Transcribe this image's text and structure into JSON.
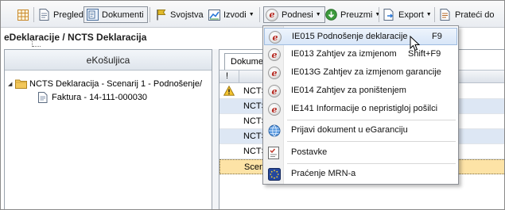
{
  "toolbar": {
    "items": [
      {
        "label": "",
        "icon": "grid-icon"
      },
      {
        "label": "Pregled",
        "icon": "page-icon"
      },
      {
        "label": "Dokumenti",
        "icon": "documents-icon"
      },
      {
        "label": "Svojstva",
        "icon": "flag-icon"
      },
      {
        "label": "Izvodi",
        "icon": "chart-icon"
      },
      {
        "label": "Podnesi",
        "icon": "e-icon"
      },
      {
        "label": "Preuzmi",
        "icon": "download-icon"
      },
      {
        "label": "Export",
        "icon": "export-icon"
      },
      {
        "label": "Prateći do",
        "icon": "tracking-icon"
      }
    ]
  },
  "breadcrumb": "eDeklaracije / NCTS Deklaracija",
  "left_panel": {
    "header": "eKošuljica",
    "tree": {
      "root": "NCTS Deklaracija - Scenarij 1 - Podnošenje/",
      "child": "Faktura - 14-111-000030"
    }
  },
  "right_panel": {
    "tab_label": "Dokume",
    "column_header": "!",
    "rows": [
      "NCTS",
      "NCTS",
      "NCTS",
      "NCTS",
      "NCTS",
      "Scen"
    ]
  },
  "menu": {
    "items": [
      {
        "label": "IE015 Podnošenje deklaracije",
        "shortcut": "F9",
        "icon": "e-icon"
      },
      {
        "label": "IE013 Zahtjev za izmjenom",
        "shortcut": "Shift+F9",
        "icon": "e-icon"
      },
      {
        "label": "IE013G Zahtjev za izmjenom garancije",
        "shortcut": "",
        "icon": "e-icon"
      },
      {
        "label": "IE014 Zahtjev za poništenjem",
        "shortcut": "",
        "icon": "e-icon"
      },
      {
        "label": "IE141 Informacije o nepristigloj pošilci",
        "shortcut": "",
        "icon": "e-icon"
      },
      {
        "label": "Prijavi dokument u eGaranciju",
        "shortcut": "",
        "icon": "globe-icon"
      },
      {
        "label": "Postavke",
        "shortcut": "",
        "icon": "checklist-icon"
      },
      {
        "label": "Praćenje MRN-a",
        "shortcut": "",
        "icon": "eu-flag-icon"
      }
    ]
  },
  "colors": {
    "menu_highlight": "#d8e6f8",
    "row_alt": "#dde7f4",
    "row_selected": "#fde3a6",
    "e_icon_red": "#b5261e"
  }
}
